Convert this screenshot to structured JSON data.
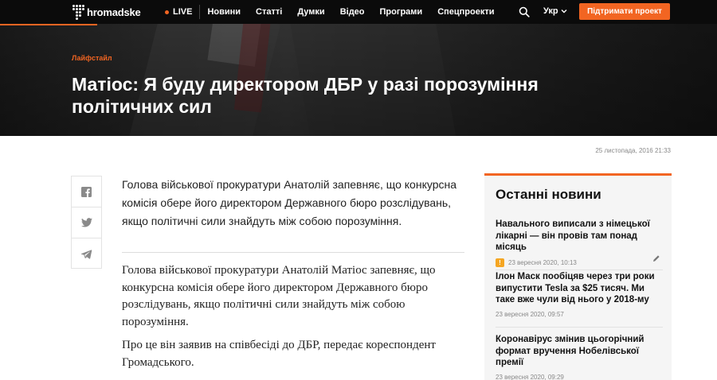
{
  "brand": {
    "name": "hromadske"
  },
  "nav": {
    "live": "LIVE",
    "links": [
      "Новини",
      "Статті",
      "Думки",
      "Відео",
      "Програми",
      "Спецпроекти"
    ],
    "lang": "Укр",
    "support": "Підтримати проект"
  },
  "article": {
    "category": "Лайфстайл",
    "title": "Матіос: Я буду директором ДБР у разі порозуміння політичних сил",
    "date": "25 листопада, 2016 21:33",
    "lead": "Голова військової прокуратури Анатолій запевняє, що конкурсна комісія обере його директором Державного бюро розслідувань, якщо політичні сили знайдуть між собою порозуміння.",
    "paragraphs": [
      "Голова військової прокуратури Анатолій Матіос запевняє, що конкурсна комісія обере його директором Державного бюро розслідувань, якщо політичні сили знайдуть між собою порозуміння.",
      "Про це він заявив на співбесіді до ДБР, передає кореспондент Громадського."
    ]
  },
  "share": [
    "facebook-icon",
    "twitter-icon",
    "telegram-icon"
  ],
  "sidebar": {
    "title": "Останні новини",
    "items": [
      {
        "title": "Навального виписали з німецької лікарні — він провів там понад місяць",
        "time": "23 вересня 2020, 10:13",
        "warning": "!"
      },
      {
        "title": "Ілон Маск пообіцяв через три роки випустити Tesla за $25 тисяч. Ми таке вже чули від нього у 2018-му",
        "time": "23 вересня 2020, 09:57"
      },
      {
        "title": "Коронавірус змінив цьогорічний формат вручення Нобелівської премії",
        "time": "23 вересня 2020, 09:29"
      }
    ]
  },
  "colors": {
    "accent": "#f26522",
    "warning": "#f5a623"
  }
}
